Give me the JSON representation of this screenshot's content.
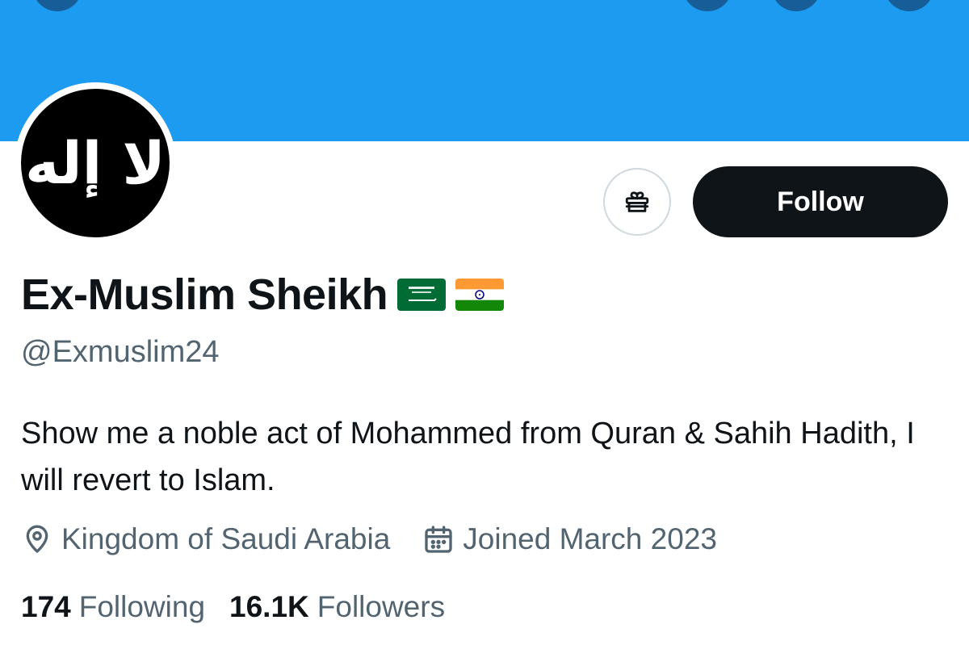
{
  "colors": {
    "banner": "#1d9bf0",
    "primary_text": "#0f1419",
    "secondary_text": "#536471",
    "follow_button_bg": "#0f1419",
    "border": "#cfd9de"
  },
  "avatar": {
    "text": "لا إله"
  },
  "actions": {
    "gift_icon": "gift-icon",
    "follow_label": "Follow"
  },
  "profile": {
    "display_name": "Ex-Muslim Sheikh",
    "flags": [
      "saudi-arabia-flag",
      "india-flag"
    ],
    "handle": "@Exmuslim24",
    "bio": "Show me a noble act of Mohammed from Quran & Sahih Hadith, I will revert to Islam.",
    "location": "Kingdom of Saudi Arabia",
    "joined": "Joined March 2023"
  },
  "stats": {
    "following_count": "174",
    "following_label": "Following",
    "followers_count": "16.1K",
    "followers_label": "Followers"
  }
}
